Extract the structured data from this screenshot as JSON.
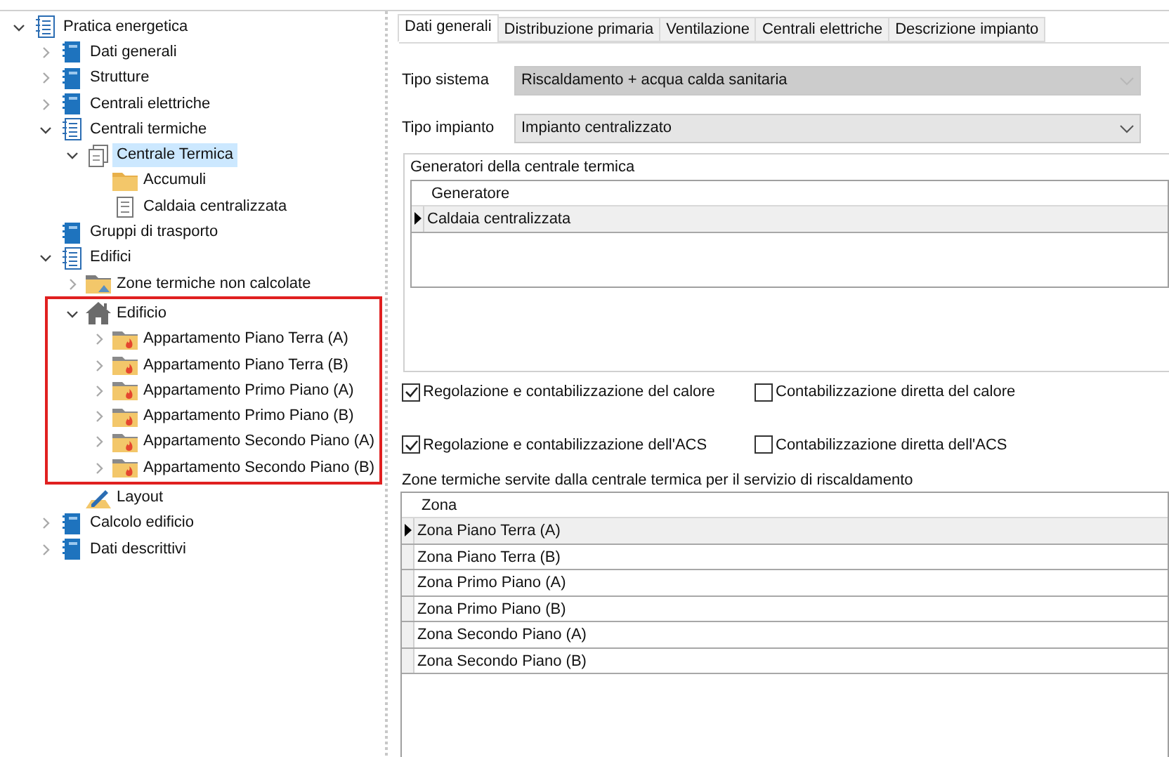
{
  "tree": [
    {
      "label": "Pratica energetica",
      "kind": "list",
      "expanded": true,
      "selected": false,
      "children": [
        {
          "label": "Dati generali",
          "kind": "notebook",
          "expanded": false,
          "selected": false
        },
        {
          "label": "Strutture",
          "kind": "notebook",
          "expanded": false,
          "selected": false
        },
        {
          "label": "Centrali elettriche",
          "kind": "notebook",
          "expanded": false,
          "selected": false
        },
        {
          "label": "Centrali termiche",
          "kind": "list",
          "expanded": true,
          "selected": false,
          "children": [
            {
              "label": "Centrale Termica",
              "kind": "stack",
              "expanded": true,
              "selected": true,
              "children": [
                {
                  "label": "Accumuli",
                  "kind": "folder",
                  "selected": false
                },
                {
                  "label": "Caldaia centralizzata",
                  "kind": "file",
                  "selected": false
                }
              ]
            }
          ]
        },
        {
          "label": "Gruppi di trasporto",
          "kind": "notebook",
          "selected": false
        },
        {
          "label": "Edifici",
          "kind": "list",
          "expanded": true,
          "selected": false,
          "children": [
            {
              "label": "Zone termiche non calcolate",
              "kind": "folder-image",
              "expanded": false,
              "selected": false
            },
            {
              "label": "Edificio",
              "kind": "house",
              "expanded": true,
              "selected": false,
              "highlighted": true,
              "children": [
                {
                  "label": "Appartamento Piano Terra (A)",
                  "kind": "folder-flame",
                  "expanded": false,
                  "selected": false
                },
                {
                  "label": "Appartamento Piano Terra (B)",
                  "kind": "folder-flame",
                  "expanded": false,
                  "selected": false
                },
                {
                  "label": "Appartamento Primo Piano (A)",
                  "kind": "folder-flame",
                  "expanded": false,
                  "selected": false
                },
                {
                  "label": "Appartamento Primo Piano (B)",
                  "kind": "folder-flame",
                  "expanded": false,
                  "selected": false
                },
                {
                  "label": "Appartamento Secondo Piano (A)",
                  "kind": "folder-flame",
                  "expanded": false,
                  "selected": false
                },
                {
                  "label": "Appartamento Secondo Piano (B)",
                  "kind": "folder-flame",
                  "expanded": false,
                  "selected": false
                }
              ]
            },
            {
              "label": "Layout",
              "kind": "pencil",
              "selected": false
            }
          ]
        },
        {
          "label": "Calcolo edificio",
          "kind": "notebook",
          "expanded": false,
          "selected": false
        },
        {
          "label": "Dati descrittivi",
          "kind": "notebook",
          "expanded": false,
          "selected": false
        }
      ]
    }
  ],
  "tabs": [
    {
      "label": "Dati generali",
      "selected": true
    },
    {
      "label": "Distribuzione primaria",
      "selected": false
    },
    {
      "label": "Ventilazione",
      "selected": false
    },
    {
      "label": "Centrali elettriche",
      "selected": false
    },
    {
      "label": "Descrizione impianto",
      "selected": false
    }
  ],
  "fields": [
    {
      "label": "Tipo sistema",
      "value": "Riscaldamento + acqua calda sanitaria",
      "disabled": true
    },
    {
      "label": "Tipo impianto",
      "value": "Impianto centralizzato",
      "disabled": false
    }
  ],
  "generators": {
    "title": "Generatori della centrale termica",
    "column": "Generatore",
    "rows": [
      {
        "cell": "Caldaia centralizzata",
        "selected": true
      }
    ]
  },
  "checkboxes": [
    [
      {
        "label": "Regolazione e contabilizzazione del calore",
        "checked": true
      },
      {
        "label": "Contabilizzazione diretta del calore",
        "checked": false
      }
    ],
    [
      {
        "label": "Regolazione e contabilizzazione dell'ACS",
        "checked": true
      },
      {
        "label": "Contabilizzazione diretta dell'ACS",
        "checked": false
      }
    ]
  ],
  "zones": {
    "title": "Zone termiche servite dalla centrale termica per il servizio di riscaldamento",
    "column": "Zona",
    "rows": [
      {
        "cell": "Zona Piano Terra (A)",
        "selected": true
      },
      {
        "cell": "Zona Piano Terra (B)",
        "selected": false
      },
      {
        "cell": "Zona Primo Piano (A)",
        "selected": false
      },
      {
        "cell": "Zona Primo Piano (B)",
        "selected": false
      },
      {
        "cell": "Zona Secondo Piano (A)",
        "selected": false
      },
      {
        "cell": "Zona Secondo Piano (B)",
        "selected": false
      }
    ]
  }
}
